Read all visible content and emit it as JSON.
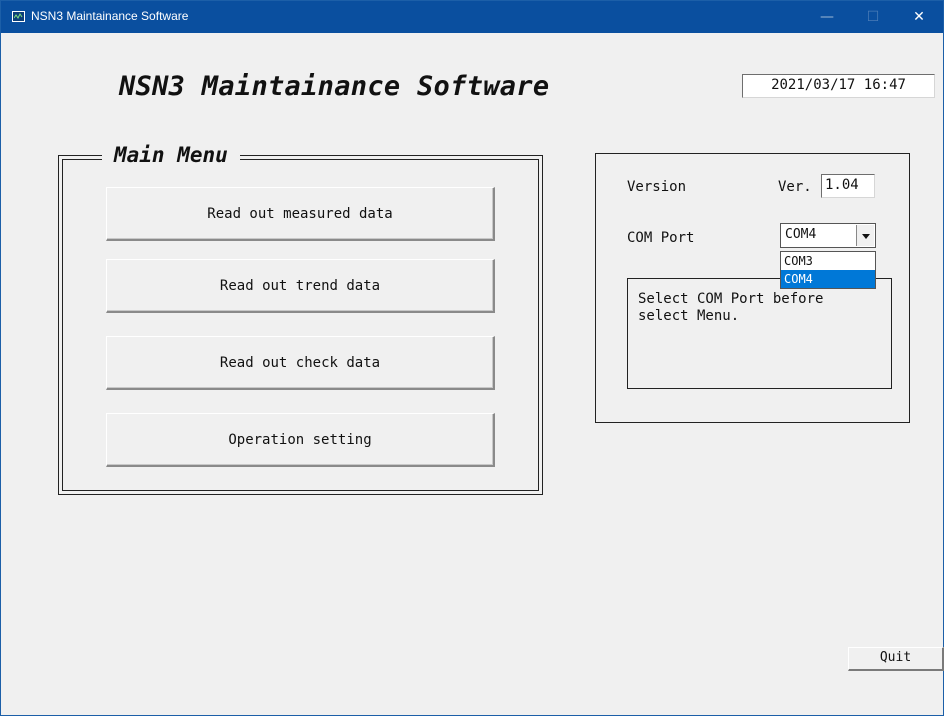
{
  "window": {
    "title": "NSN3 Maintainance Software",
    "controls": {
      "minimize": "—",
      "maximize": "☐",
      "close": "✕"
    },
    "icon": "chart-line-icon"
  },
  "header": {
    "app_title": "NSN3 Maintainance Software",
    "datetime": "2021/03/17 16:47"
  },
  "main_menu": {
    "legend": "Main Menu",
    "buttons": [
      "Read out measured data",
      "Read out trend data",
      "Read out check data",
      "Operation setting"
    ]
  },
  "info_panel": {
    "version_label": "Version",
    "version_prefix": "Ver.",
    "version_value": "1.04",
    "com_label": "COM Port",
    "com_selected": "COM4",
    "com_options": [
      "COM3",
      "COM4"
    ],
    "message": "Select COM Port before\nselect Menu."
  },
  "footer": {
    "quit_label": "Quit"
  },
  "colors": {
    "titlebar": "#0a4f9f",
    "selection": "#0078d7",
    "background": "#f0f0f0"
  }
}
